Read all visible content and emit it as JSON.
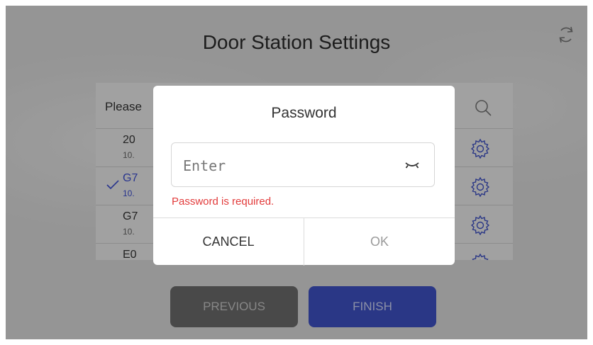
{
  "header": {
    "title": "Door Station Settings",
    "refresh_icon": "refresh-icon"
  },
  "list": {
    "hint": "Please",
    "search_icon": "search-icon",
    "rows": [
      {
        "name": "20",
        "ip": "10.",
        "selected": false
      },
      {
        "name": "G7",
        "ip": "10.",
        "selected": true
      },
      {
        "name": "G7",
        "ip": "10.",
        "selected": false
      },
      {
        "name": "E0",
        "ip": "",
        "selected": false
      }
    ]
  },
  "footer": {
    "previous_label": "PREVIOUS",
    "finish_label": "FINISH"
  },
  "dialog": {
    "title": "Password",
    "input_placeholder": "Enter",
    "input_value": "",
    "error": "Password is required.",
    "cancel_label": "CANCEL",
    "ok_label": "OK"
  },
  "colors": {
    "accent": "#3f51c6",
    "selected_text": "#3d4fd1",
    "error": "#e23b3b"
  }
}
